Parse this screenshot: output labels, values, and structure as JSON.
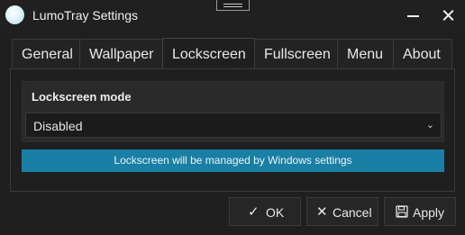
{
  "window": {
    "title": "LumoTray Settings",
    "icons": {
      "app": "lumotray-logo-icon",
      "minimize": "minimize-icon",
      "close": "close-icon",
      "drag": "drag-handle-icon"
    }
  },
  "tabs": [
    {
      "label": "General",
      "active": false
    },
    {
      "label": "Wallpaper",
      "active": false
    },
    {
      "label": "Lockscreen",
      "active": true
    },
    {
      "label": "Fullscreen",
      "active": false
    },
    {
      "label": "Menu",
      "active": false
    },
    {
      "label": "About",
      "active": false
    }
  ],
  "lockscreen": {
    "mode_label": "Lockscreen mode",
    "mode_value": "Disabled",
    "info": "Lockscreen will be managed by Windows settings"
  },
  "buttons": {
    "ok": "OK",
    "cancel": "Cancel",
    "apply": "Apply"
  },
  "colors": {
    "background": "#1f1f1f",
    "info_bar": "#1a7fa5",
    "text": "#e6e6e6"
  }
}
